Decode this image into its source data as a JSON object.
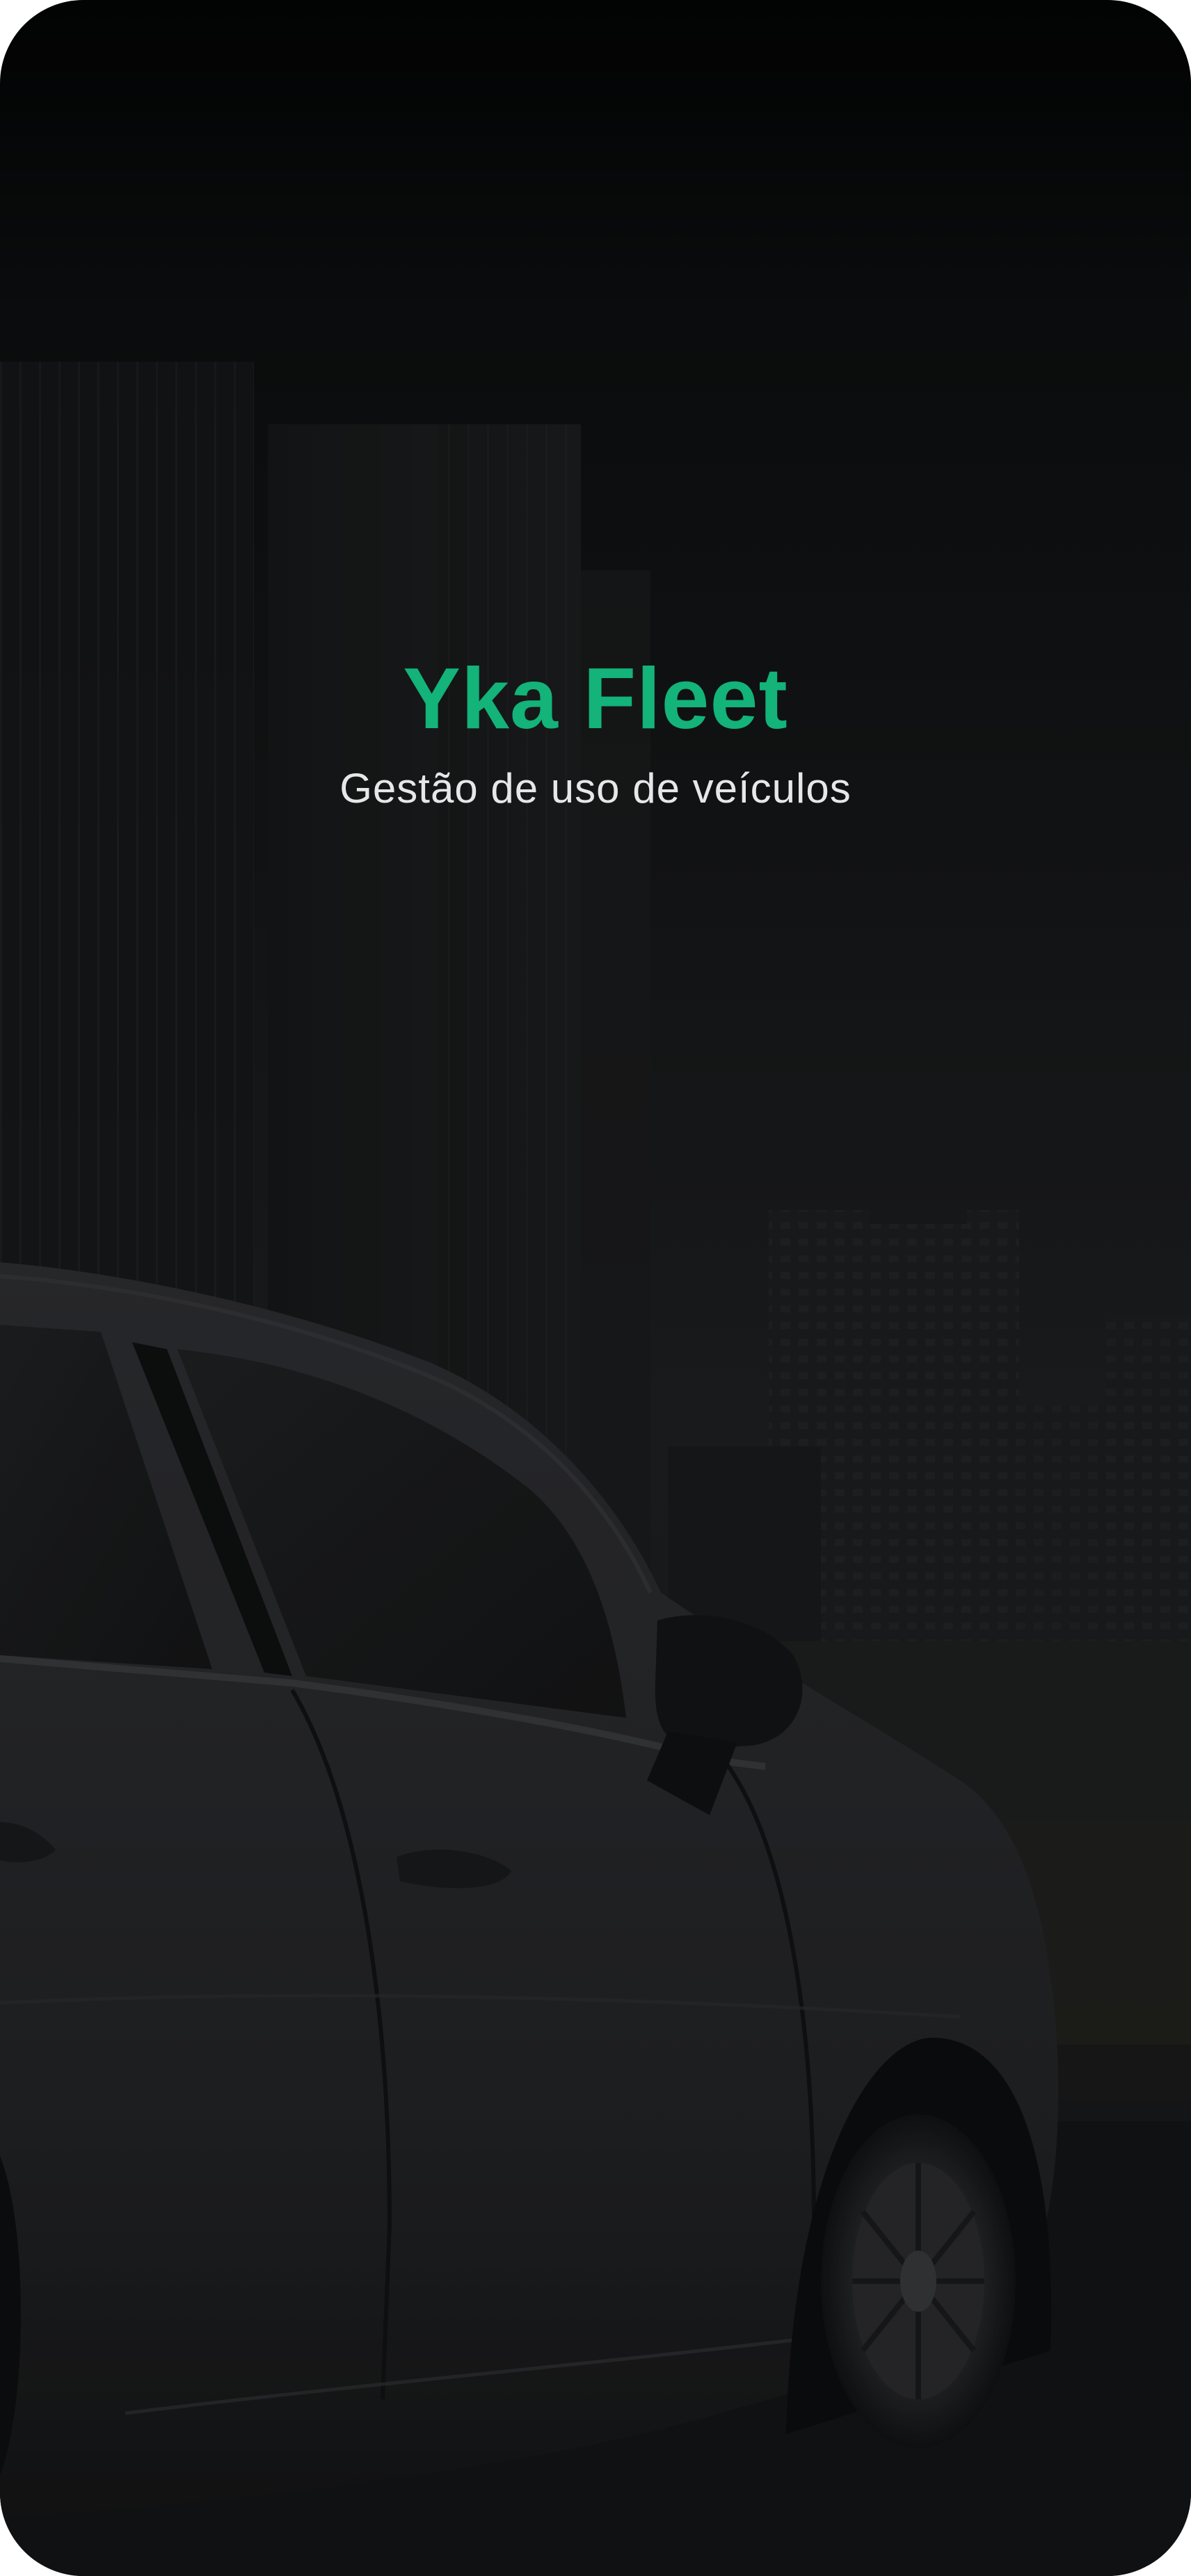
{
  "splash": {
    "app_name": "Yka Fleet",
    "tagline": "Gestão de uso de veículos"
  },
  "theme": {
    "brand_color": "#13b37a",
    "background_color": "#1c1e20",
    "tagline_color": "#e6e7e8"
  }
}
